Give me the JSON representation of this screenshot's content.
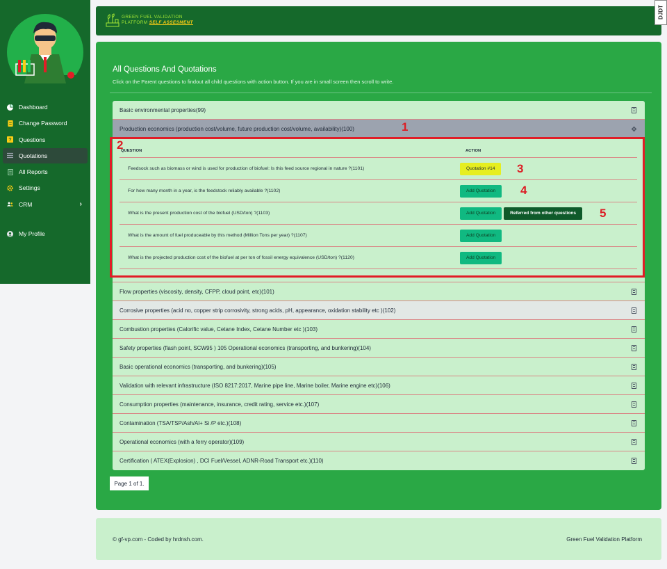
{
  "brand": {
    "name_line1": "GREEN FUEL VALIDATION",
    "name_line2_prefix": "PLATFORM",
    "name_line2_tag": "SELF ASSESMENT",
    "badge": "DJDT"
  },
  "sidebar": {
    "items": [
      {
        "label": "Dashboard",
        "icon": "pie-chart-icon"
      },
      {
        "label": "Change Password",
        "icon": "document-icon"
      },
      {
        "label": "Questions",
        "icon": "question-icon"
      },
      {
        "label": "Quotations",
        "icon": "list-icon"
      },
      {
        "label": "All Reports",
        "icon": "report-icon"
      },
      {
        "label": "Settings",
        "icon": "gear-icon"
      },
      {
        "label": "CRM",
        "icon": "users-icon"
      },
      {
        "label": "My Profile",
        "icon": "user-circle-icon"
      }
    ],
    "active": "Quotations"
  },
  "main": {
    "title": "All Questions And Quotations",
    "subtitle": "Click on the Parent questions to findout all child questions with action button. If you are in small screen then scroll to write.",
    "parents": [
      {
        "label": "Basic environmental properties(99)"
      },
      {
        "label": "Production economics (production cost/volume, future production cost/volume, availability)(100)"
      },
      {
        "label": "Flow properties (viscosity, density, CFPP, cloud point, etc)(101)"
      },
      {
        "label": "Corrosive properties (acid no, copper strip corrosivity, strong acids, pH, appearance, oxidation stability etc )(102)"
      },
      {
        "label": "Combustion properties (Calorific value, Cetane Index, Cetane Number etc )(103)"
      },
      {
        "label": "Safety properties (flash point, SCW95 ) 105 Operational economics (transporting, and bunkering)(104)"
      },
      {
        "label": "Basic operational economics (transporting, and bunkering)(105)"
      },
      {
        "label": "Validation with relevant infrastructure (ISO 8217:2017, Marine pipe line, Marine boiler, Marine engine etc)(106)"
      },
      {
        "label": "Consumption properties (maintenance, insurance, credit rating, service etc.)(107)"
      },
      {
        "label": "Contamination (TSA/TSP/Ash/Al+ Si /P etc.)(108)"
      },
      {
        "label": "Operational economics (with a ferry operator)(109)"
      },
      {
        "label": "Certification ( ATEX(Explosion) , DCI Fuel/Vessel, ADNR-Road Transport etc.)(110)"
      }
    ],
    "table": {
      "col_question": "QUESTION",
      "col_action": "ACTION",
      "rows": [
        {
          "question": "Feedsock such as biomass or wind is used for production of biofuel: Is this feed source regional in nature ?(1101)",
          "action": "Quotation #14"
        },
        {
          "question": "For how many month in a year, is the feedstock reliably available ?(1102)",
          "action": "Add Quotation"
        },
        {
          "question": "What is the present production cost of the biofuel (USD/ton) ?(1103)",
          "action": "Add Quotation",
          "action2": "Referred from other questions"
        },
        {
          "question": "What is the amount of fuel produceable by this method (Million Tons per year) ?(1107)",
          "action": "Add Quotation"
        },
        {
          "question": "What is the projected production cost of the biofuel at per ton of fossil energy equivalence (USD/ton) ?(1120)",
          "action": "Add Quotation"
        }
      ]
    },
    "pager": "Page 1 of 1."
  },
  "markers": [
    "1",
    "2",
    "3",
    "4",
    "5"
  ],
  "footer": {
    "left": "© gf-vp.com - Coded by hrdnsh.com.",
    "right": "Green Fuel Validation Platform"
  },
  "colors": {
    "sidebar": "#15692b",
    "main": "#2aa845",
    "panel": "#c9f0cc",
    "accent_yellow": "#e6ee1f",
    "annotation_red": "#e11d27"
  }
}
